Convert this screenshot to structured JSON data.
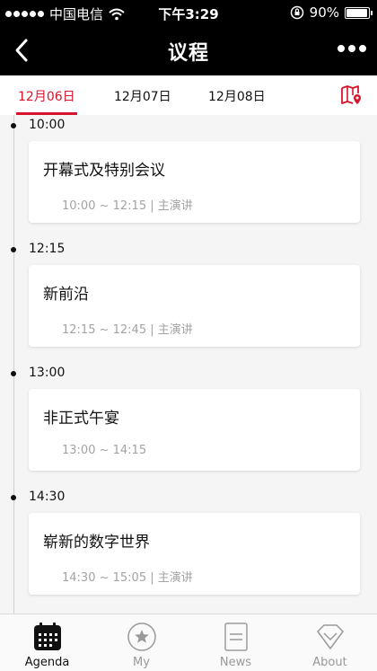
{
  "status_bar": {
    "carrier": "中国电信",
    "time": "下午3:29",
    "battery": "90%",
    "signal_icon": "signal-dots-icon",
    "wifi_icon": "wifi-icon",
    "lock_icon": "rotation-lock-icon",
    "battery_level": 0.9
  },
  "nav": {
    "title": "议程",
    "back_icon": "chevron-left-icon",
    "more_icon": "more-dots-icon"
  },
  "dates": {
    "tabs": [
      "12月06日",
      "12月07日",
      "12月08日"
    ],
    "active_index": 0,
    "map_icon": "map-pin-icon"
  },
  "agenda": [
    {
      "time": "10:00",
      "title": "开幕式及特别会议",
      "meta": "10:00 ~ 12:15 | 主演讲"
    },
    {
      "time": "12:15",
      "title": "新前沿",
      "meta": "12:15 ~ 12:45 | 主演讲"
    },
    {
      "time": "13:00",
      "title": "非正式午宴",
      "meta": "13:00 ~ 14:15"
    },
    {
      "time": "14:30",
      "title": "崭新的数字世界",
      "meta": "14:30 ~ 15:05 | 主演讲"
    }
  ],
  "tabbar": {
    "items": [
      {
        "label": "Agenda",
        "icon": "calendar-icon"
      },
      {
        "label": "My",
        "icon": "star-icon"
      },
      {
        "label": "News",
        "icon": "document-icon"
      },
      {
        "label": "About",
        "icon": "diamond-icon"
      }
    ],
    "active_index": 0
  },
  "colors": {
    "accent": "#d8142d",
    "header_bg": "#000000",
    "page_bg": "#f5f5f5"
  }
}
